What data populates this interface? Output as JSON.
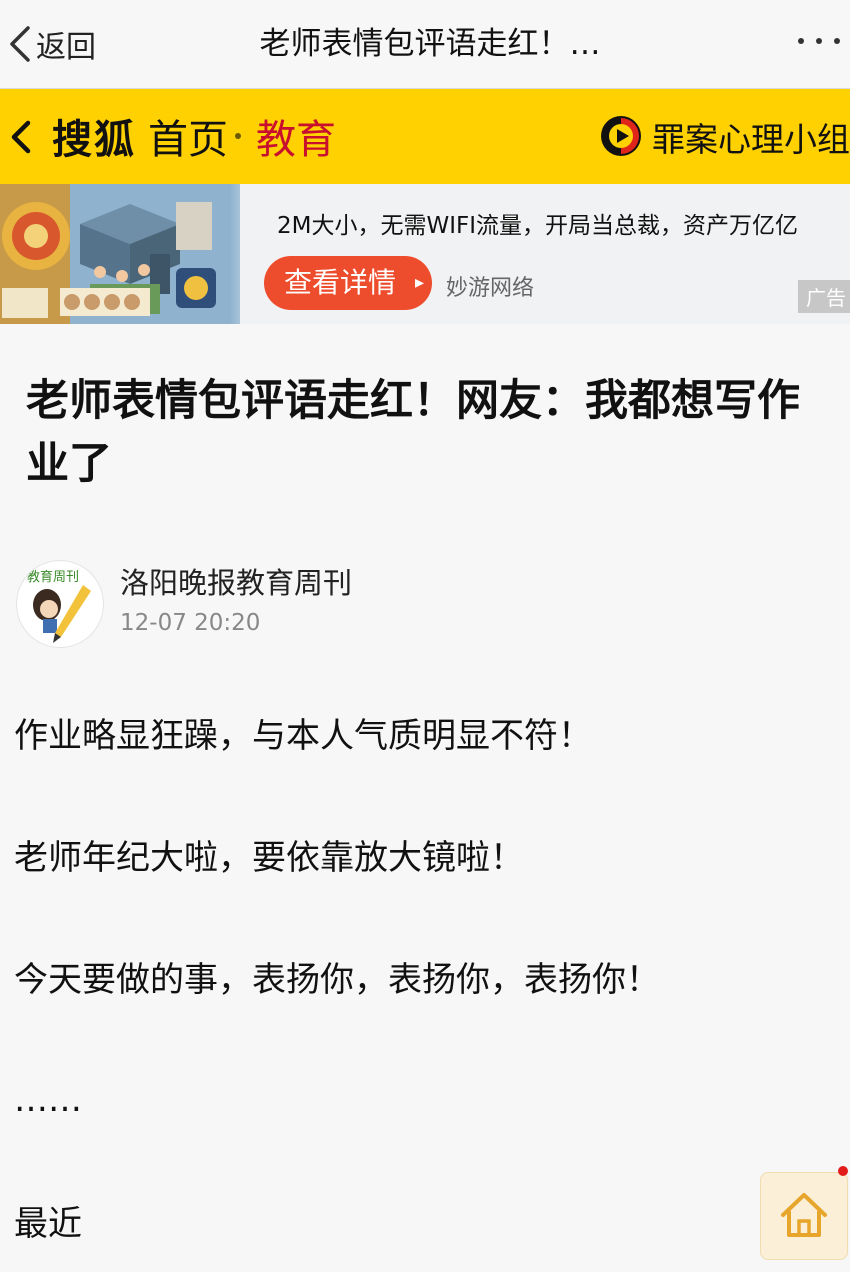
{
  "nav": {
    "back_label": "返回",
    "title": "老师表情包评语走红！…"
  },
  "channel_bar": {
    "brand": "搜狐",
    "home": "首页",
    "section": "教育",
    "channel_name": "罪案心理小组"
  },
  "ad": {
    "description": "2M大小，无需WIFI流量，开局当总裁，资产万亿亿",
    "cta_label": "查看详情",
    "advertiser": "妙游网络",
    "tag": "广告"
  },
  "article": {
    "title": "老师表情包评语走红！网友：我都想写作业了",
    "author": "洛阳晚报教育周刊",
    "avatar_text": "教育周刊",
    "time": "12-07 20:20",
    "paragraphs": [
      "作业略显狂躁，与本人气质明显不符！",
      "老师年纪大啦，要依靠放大镜啦！",
      "今天要做的事，表扬你，表扬你，表扬你！",
      "……"
    ],
    "recent_label": "最近"
  },
  "colors": {
    "channel_bar_bg": "#ffd100",
    "section_red": "#c8102e",
    "cta_orange": "#ee4d2d"
  },
  "icons": {
    "nav_back": "chevron-left-icon",
    "nav_more": "more-dots-icon",
    "channel_back": "chevron-left-icon",
    "channel_logo": "play-logo-icon",
    "fab": "home-icon"
  }
}
